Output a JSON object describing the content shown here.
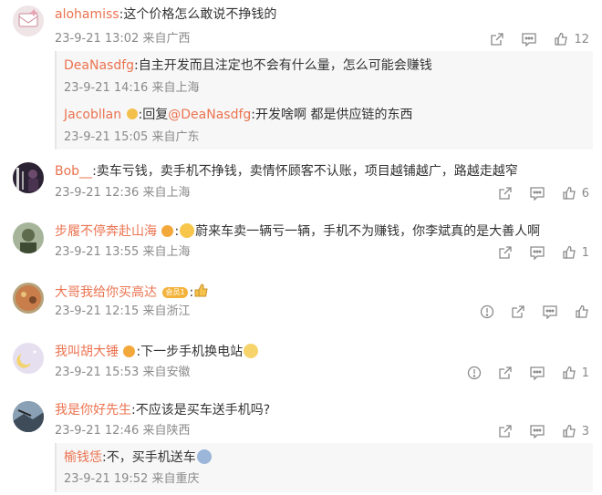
{
  "comments": [
    {
      "name": "alohamiss",
      "text": ":这个价格怎么敢说不挣钱的",
      "time": "23-9-21 13:02",
      "location": "来自广西",
      "likes": "12",
      "replies": [
        {
          "name": "DeaNasdfg",
          "text": ":自主开发而且注定也不会有什么量，怎么可能会赚钱",
          "time": "23-9-21 14:16",
          "location": "来自上海"
        },
        {
          "name": "Jacobllan",
          "reply_prefix": ":回复",
          "mention": "@DeaNasdfg",
          "text": ":开发啥啊 都是供应链的东西",
          "time": "23-9-21 15:05",
          "location": "来自广东"
        }
      ]
    },
    {
      "name": "Bob__",
      "text": ":卖车亏钱，卖手机不挣钱，卖情怀顾客不认账，项目越铺越广，路越走越窄",
      "time": "23-9-21 12:36",
      "location": "来自上海",
      "likes": "6"
    },
    {
      "name": "步履不停奔赴山海",
      "text_before": ":",
      "text": "蔚来车卖一辆亏一辆，手机不为赚钱，你李斌真的是大善人啊",
      "time": "23-9-21 13:55",
      "location": "来自上海",
      "likes": "1"
    },
    {
      "name": "大哥我给你买高达",
      "badge": "会员1",
      "text": ":",
      "time": "23-9-21 12:15",
      "location": "来自浙江",
      "likes": ""
    },
    {
      "name": "我叫胡大锤",
      "text": ":下一步手机换电站",
      "time": "23-9-21 15:53",
      "location": "来自安徽",
      "likes": "1"
    },
    {
      "name": "我是你好先生",
      "text": ":不应该是买车送手机吗?",
      "time": "23-9-21 12:46",
      "location": "来自陕西",
      "likes": "3",
      "replies": [
        {
          "name": "榆钱恁",
          "text": ":不，买手机送车",
          "time": "23-9-21 19:52",
          "location": "来自重庆"
        }
      ]
    }
  ],
  "icons": {
    "share": "share-icon",
    "comment": "comment-icon",
    "like": "like-icon",
    "report": "report-icon"
  },
  "colors": {
    "username": "#eb7350",
    "meta": "#8a8a8a",
    "text": "#333333",
    "reply_bg": "#f7f7f7"
  }
}
